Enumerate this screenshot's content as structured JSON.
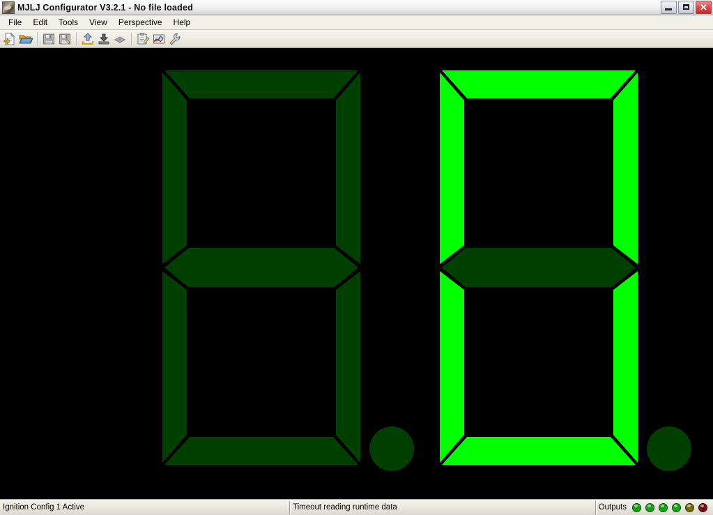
{
  "window": {
    "title": "MJLJ Configurator V3.2.1 - No file loaded",
    "app_icon": "app-icon",
    "controls": {
      "minimize": "Minimize",
      "restore": "Restore",
      "close": "Close"
    }
  },
  "menubar": {
    "items": [
      {
        "label": "File"
      },
      {
        "label": "Edit"
      },
      {
        "label": "Tools"
      },
      {
        "label": "View"
      },
      {
        "label": "Perspective"
      },
      {
        "label": "Help"
      }
    ]
  },
  "toolbar": {
    "buttons": [
      {
        "name": "new-file-icon",
        "title": "New"
      },
      {
        "name": "open-folder-icon",
        "title": "Open"
      },
      {
        "name": "save-icon",
        "title": "Save"
      },
      {
        "name": "save-as-icon",
        "title": "Save As"
      },
      {
        "name": "upload-icon",
        "title": "Write to device"
      },
      {
        "name": "download-icon",
        "title": "Read from device"
      },
      {
        "name": "connect-icon",
        "title": "Connect"
      },
      {
        "name": "clipboard-edit-icon",
        "title": "Configuration"
      },
      {
        "name": "chart-icon",
        "title": "Runtime graph"
      },
      {
        "name": "wrench-icon",
        "title": "Tools"
      }
    ]
  },
  "display": {
    "background_color": "#000000",
    "segment_on_color": "#00FF00",
    "segment_off_color": "#003F00",
    "digits": [
      {
        "name": "digit-left",
        "value": "",
        "segments": {
          "a": "off",
          "b": "off",
          "c": "off",
          "d": "off",
          "e": "off",
          "f": "off",
          "g": "off"
        },
        "decimal_point": "off"
      },
      {
        "name": "digit-right",
        "value": "0",
        "segments": {
          "a": "on",
          "b": "on",
          "c": "on",
          "d": "on",
          "e": "on",
          "f": "on",
          "g": "off"
        },
        "decimal_point": "off"
      }
    ]
  },
  "statusbar": {
    "left_text": "Ignition Config 1 Active",
    "center_text": "Timeout reading runtime data",
    "outputs_label": "Outputs",
    "outputs": [
      {
        "name": "output-led-1",
        "state": "on",
        "color": "#13A313"
      },
      {
        "name": "output-led-2",
        "state": "on",
        "color": "#13A313"
      },
      {
        "name": "output-led-3",
        "state": "on",
        "color": "#13A313"
      },
      {
        "name": "output-led-4",
        "state": "on",
        "color": "#13A313"
      },
      {
        "name": "output-led-5",
        "state": "dim",
        "color": "#6E6A10"
      },
      {
        "name": "output-led-6",
        "state": "dim",
        "color": "#6E1212"
      }
    ]
  }
}
